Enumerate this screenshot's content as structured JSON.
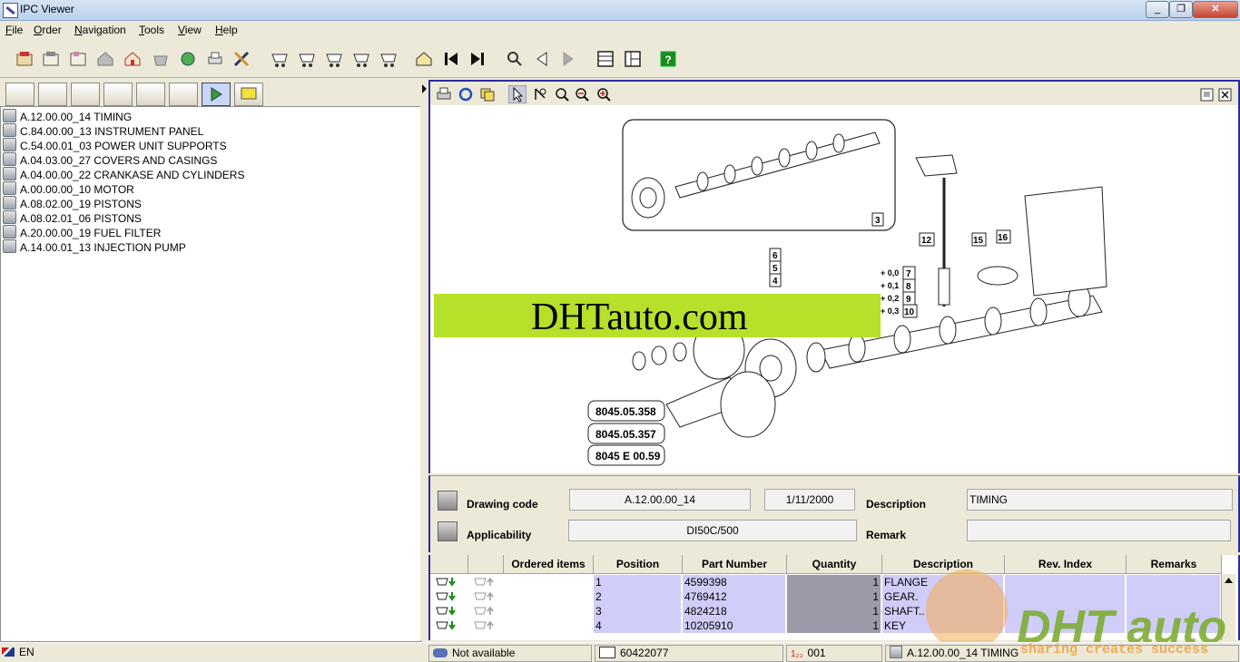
{
  "window": {
    "title": "IPC Viewer",
    "controls": [
      "_",
      "❐",
      "✕"
    ]
  },
  "menu": {
    "items": [
      "File",
      "Order",
      "Navigation",
      "Tools",
      "View",
      "Help"
    ],
    "accels": [
      "F",
      "O",
      "N",
      "T",
      "V",
      "H"
    ]
  },
  "colors": {
    "accent": "#2b2ba0",
    "grid_highlight": "#d0cdf8",
    "qty_col": "#9c9aa8",
    "banner": "#b6e02a"
  },
  "tree": {
    "items": [
      "A.12.00.00_14 TIMING",
      "C.84.00.00_13 INSTRUMENT PANEL",
      "C.54.00.01_03 POWER UNIT SUPPORTS",
      "A.04.03.00_27 COVERS AND CASINGS",
      "A.04.00.00_22 CRANKASE AND CYLINDERS",
      "A.00.00.00_10 MOTOR",
      "A.08.02.00_19 PISTONS",
      "A.08.02.01_06 PISTONS",
      "A.20.00.00_19 FUEL FILTER",
      "A.14.00.01_13 INJECTION PUMP"
    ]
  },
  "drawing": {
    "callouts": [
      "3",
      "6",
      "5",
      "4",
      "7",
      "8",
      "9",
      "10",
      "12",
      "15",
      "16"
    ],
    "clearances": [
      "+ 0,0",
      "+ 0,1",
      "+ 0,2",
      "+ 0,3"
    ],
    "part_refs": [
      "8045.05.358",
      "8045.05.357",
      "8045 E 00.59"
    ],
    "watermark": "DHTauto.com"
  },
  "properties": {
    "drawing_code_label": "Drawing code",
    "drawing_code": "A.12.00.00_14",
    "date": "1/11/2000",
    "description_label": "Description",
    "description": "TIMING",
    "applicability_label": "Applicability",
    "applicability": "DI50C/500",
    "remark_label": "Remark",
    "remark": ""
  },
  "grid": {
    "columns": [
      "Ordered items",
      "Position",
      "Part Number",
      "Quantity",
      "Description",
      "Rev. Index",
      "Remarks"
    ],
    "rows": [
      {
        "position": "1",
        "part": "4599398",
        "qty": "1",
        "desc": "FLANGE"
      },
      {
        "position": "2",
        "part": "4769412",
        "qty": "1",
        "desc": "GEAR."
      },
      {
        "position": "3",
        "part": "4824218",
        "qty": "1",
        "desc": "SHAFT.."
      },
      {
        "position": "4",
        "part": "10205910",
        "qty": "1",
        "desc": "KEY"
      }
    ]
  },
  "statusbar": {
    "language": "EN",
    "connection": "Not available",
    "order_number": "60422077",
    "counter": "001",
    "current_table": "A.12.00.00_14 TIMING"
  },
  "brand_watermark": {
    "text": "DHT auto",
    "slogan": "sharing creates success"
  }
}
